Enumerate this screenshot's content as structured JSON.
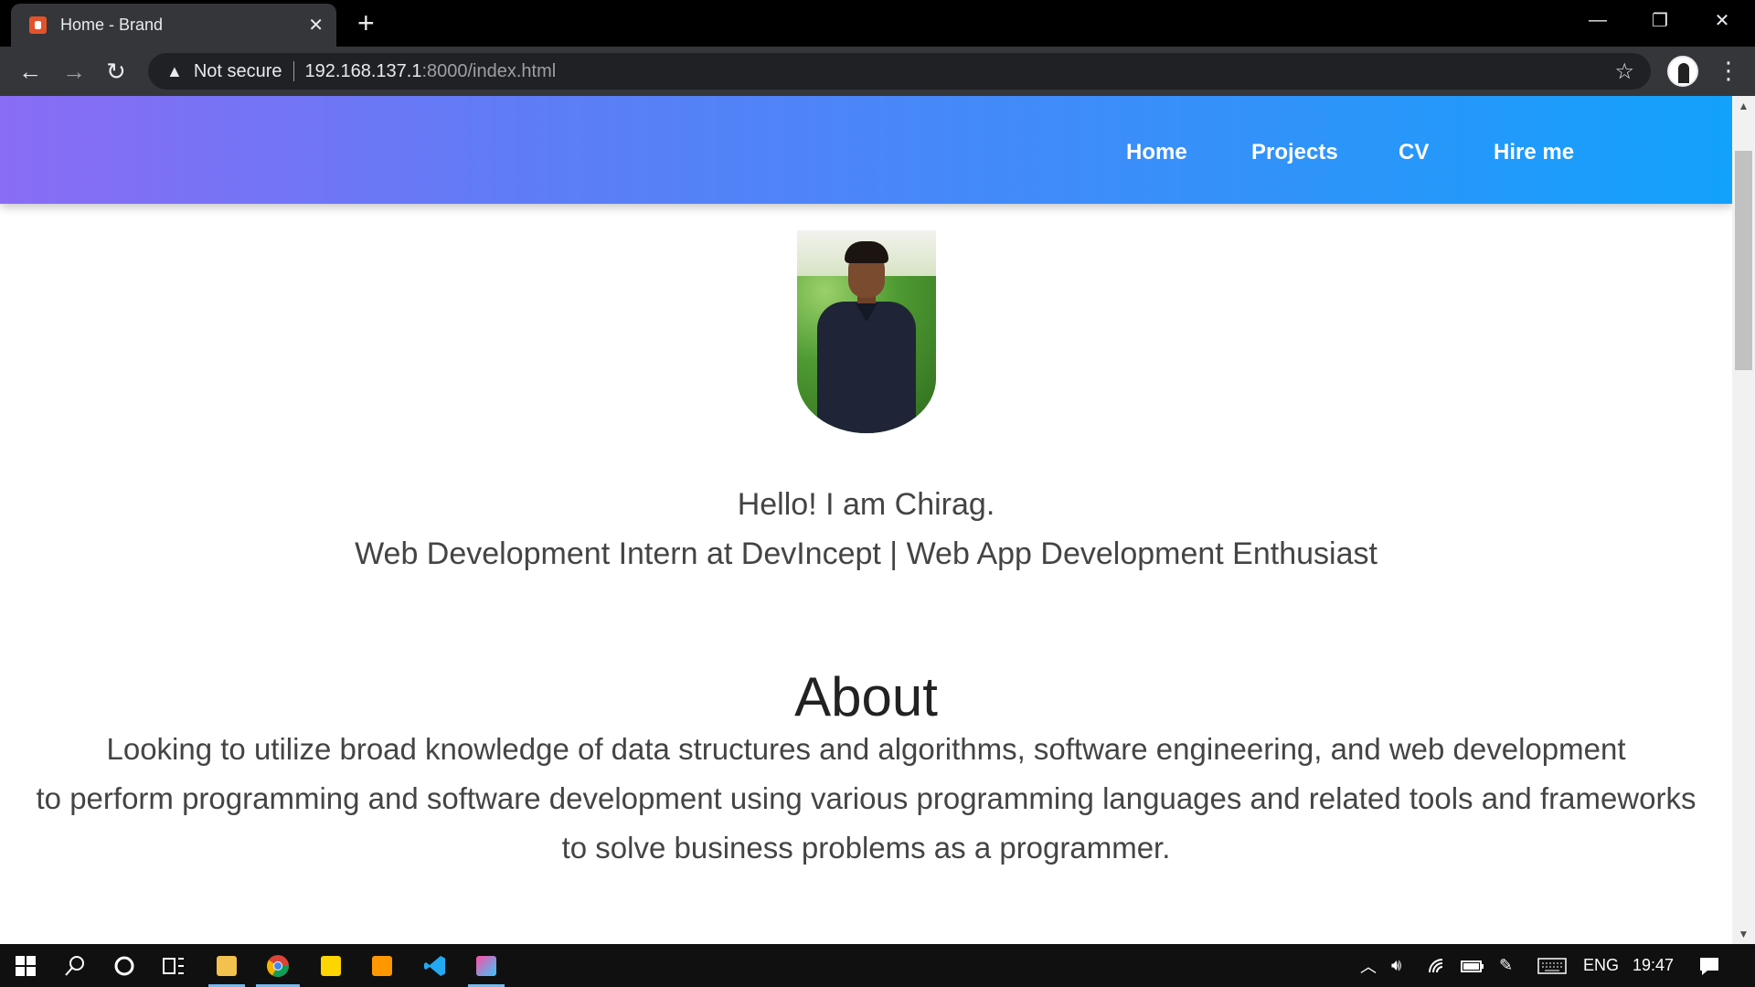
{
  "browser": {
    "tab_title": "Home - Brand",
    "new_tab_icon": "+",
    "security_label": "Not secure",
    "url_host": "192.168.137.1",
    "url_path": ":8000/index.html"
  },
  "site": {
    "nav": [
      "Home",
      "Projects",
      "CV",
      "Hire me"
    ],
    "hello_line1": "Hello! I am Chirag.",
    "hello_line2": "Web Development Intern at DevIncept | Web App Development Enthusiast",
    "about_heading": "About",
    "about_lines": [
      "Looking to utilize broad knowledge of data structures and algorithms, software engineering, and web development",
      "to perform programming and software development using various programming languages and related tools and frameworks",
      "to solve business problems as a programmer."
    ],
    "colors": {
      "gradient_start": "#8a6cf5",
      "gradient_end": "#12a1fb"
    }
  },
  "taskbar": {
    "lang": "ENG",
    "time": "19:47"
  }
}
